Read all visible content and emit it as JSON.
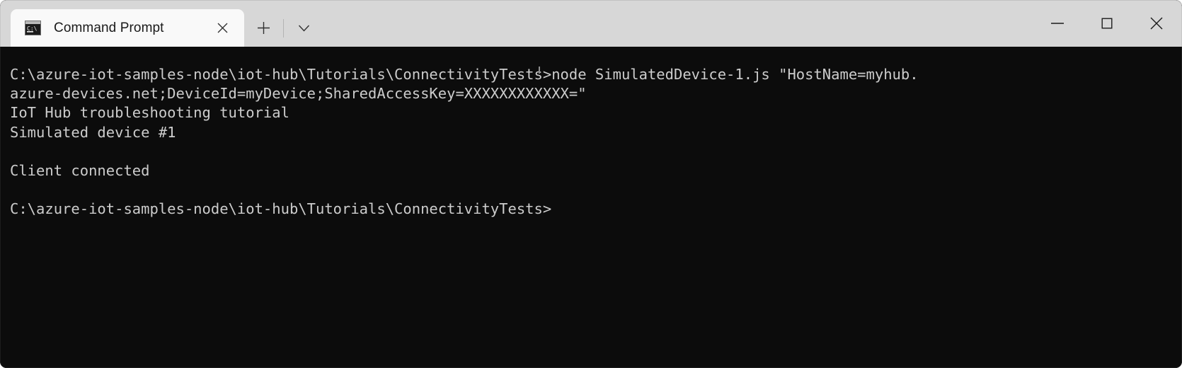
{
  "window": {
    "app_kind": "windows-terminal",
    "titlebar_color": "#d7d7d7",
    "terminal_bg_color": "#0c0c0c",
    "terminal_fg_color": "#cccccc"
  },
  "tabs": [
    {
      "label": "Command Prompt",
      "icon": "command-prompt-icon",
      "active": true,
      "close_icon": "close-icon"
    }
  ],
  "tab_actions": {
    "new_tab_icon": "plus-icon",
    "new_tab_label": "+",
    "dropdown_icon": "chevron-down-icon",
    "dropdown_label": "⌄"
  },
  "window_controls": {
    "minimize_icon": "minimize-icon",
    "maximize_icon": "maximize-icon",
    "close_icon": "close-icon"
  },
  "terminal": {
    "prompt_path": "C:\\azure-iot-samples-node\\iot-hub\\Tutorials\\ConnectivityTests>",
    "command": "node SimulatedDevice-1.js \"HostName=myhub.azure-devices.net;DeviceId=myDevice;SharedAccessKey=XXXXXXXXXXXX=\"",
    "lines": [
      "C:\\azure-iot-samples-node\\iot-hub\\Tutorials\\ConnectivityTests>node SimulatedDevice-1.js \"HostName=myhub.",
      "azure-devices.net;DeviceId=myDevice;SharedAccessKey=XXXXXXXXXXXX=\"",
      "IoT Hub troubleshooting tutorial",
      "Simulated device #1",
      "",
      "Client connected",
      "",
      "C:\\azure-iot-samples-node\\iot-hub\\Tutorials\\ConnectivityTests>"
    ],
    "content": "C:\\azure-iot-samples-node\\iot-hub\\Tutorials\\ConnectivityTests>node SimulatedDevice-1.js \"HostName=myhub.\nazure-devices.net;DeviceId=myDevice;SharedAccessKey=XXXXXXXXXXXX=\"\nIoT Hub troubleshooting tutorial\nSimulated device #1\n\nClient connected\n\nC:\\azure-iot-samples-node\\iot-hub\\Tutorials\\ConnectivityTests>"
  }
}
